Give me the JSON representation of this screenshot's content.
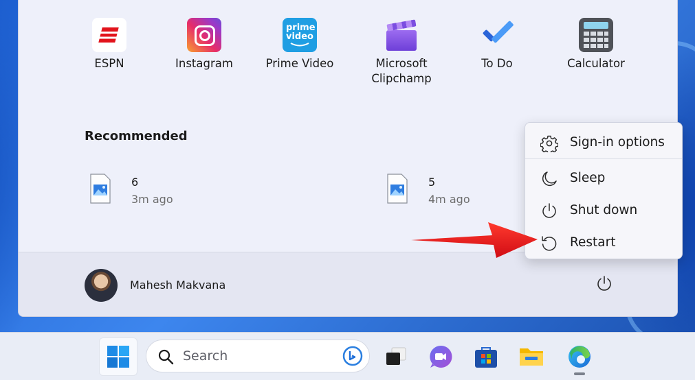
{
  "pinned_apps": [
    {
      "label": "ESPN",
      "icon": "espn-icon"
    },
    {
      "label": "Instagram",
      "icon": "instagram-icon"
    },
    {
      "label": "Prime Video",
      "icon": "prime-video-icon",
      "tile_text": "prime video"
    },
    {
      "label": "Microsoft Clipchamp",
      "icon": "clipchamp-icon"
    },
    {
      "label": "To Do",
      "icon": "todo-icon"
    },
    {
      "label": "Calculator",
      "icon": "calculator-icon"
    }
  ],
  "recommended": {
    "title": "Recommended",
    "items": [
      {
        "name": "6",
        "time": "3m ago",
        "icon": "image-file-icon"
      },
      {
        "name": "5",
        "time": "4m ago",
        "icon": "image-file-icon"
      }
    ]
  },
  "user": {
    "name": "Mahesh Makvana",
    "icon": "avatar"
  },
  "power_menu": {
    "items": [
      {
        "label": "Sign-in options",
        "icon": "gear-icon"
      },
      {
        "label": "Sleep",
        "icon": "moon-icon"
      },
      {
        "label": "Shut down",
        "icon": "power-icon"
      },
      {
        "label": "Restart",
        "icon": "restart-icon"
      }
    ]
  },
  "taskbar": {
    "search_placeholder": "Search",
    "apps": [
      "start-icon",
      "task-view-icon",
      "teams-icon",
      "store-icon",
      "file-explorer-icon",
      "edge-icon"
    ]
  },
  "colors": {
    "accent": "#0067c0",
    "arrow": "#e8141b",
    "menu_bg": "#eef0fa"
  }
}
